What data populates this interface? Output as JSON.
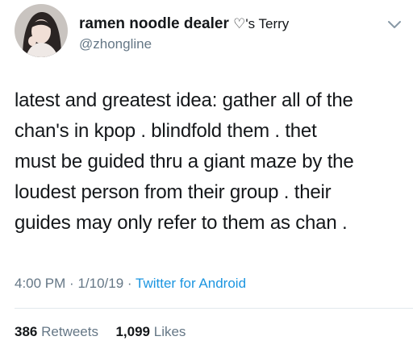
{
  "author": {
    "display_name": "ramen noodle dealer",
    "heart_suffix": "♡'s Terry",
    "handle": "@zhongline"
  },
  "tweet": {
    "lines": [
      "latest and greatest idea: gather all of the",
      "chan's in kpop . blindfold them .  thet",
      "must be guided thru a giant maze by the",
      "loudest person from their group . their",
      "guides may only refer to them as chan ."
    ],
    "time": "4:00 PM",
    "date": "1/10/19",
    "separator": "·",
    "source": "Twitter for Android"
  },
  "stats": {
    "retweets_count": "386",
    "retweets_label": "Retweets",
    "likes_count": "1,099",
    "likes_label": "Likes"
  },
  "icons": {
    "menu": "chevron-down-icon"
  },
  "colors": {
    "link": "#1b95e0",
    "secondary_text": "#657786",
    "divider": "#e1e8ed"
  }
}
